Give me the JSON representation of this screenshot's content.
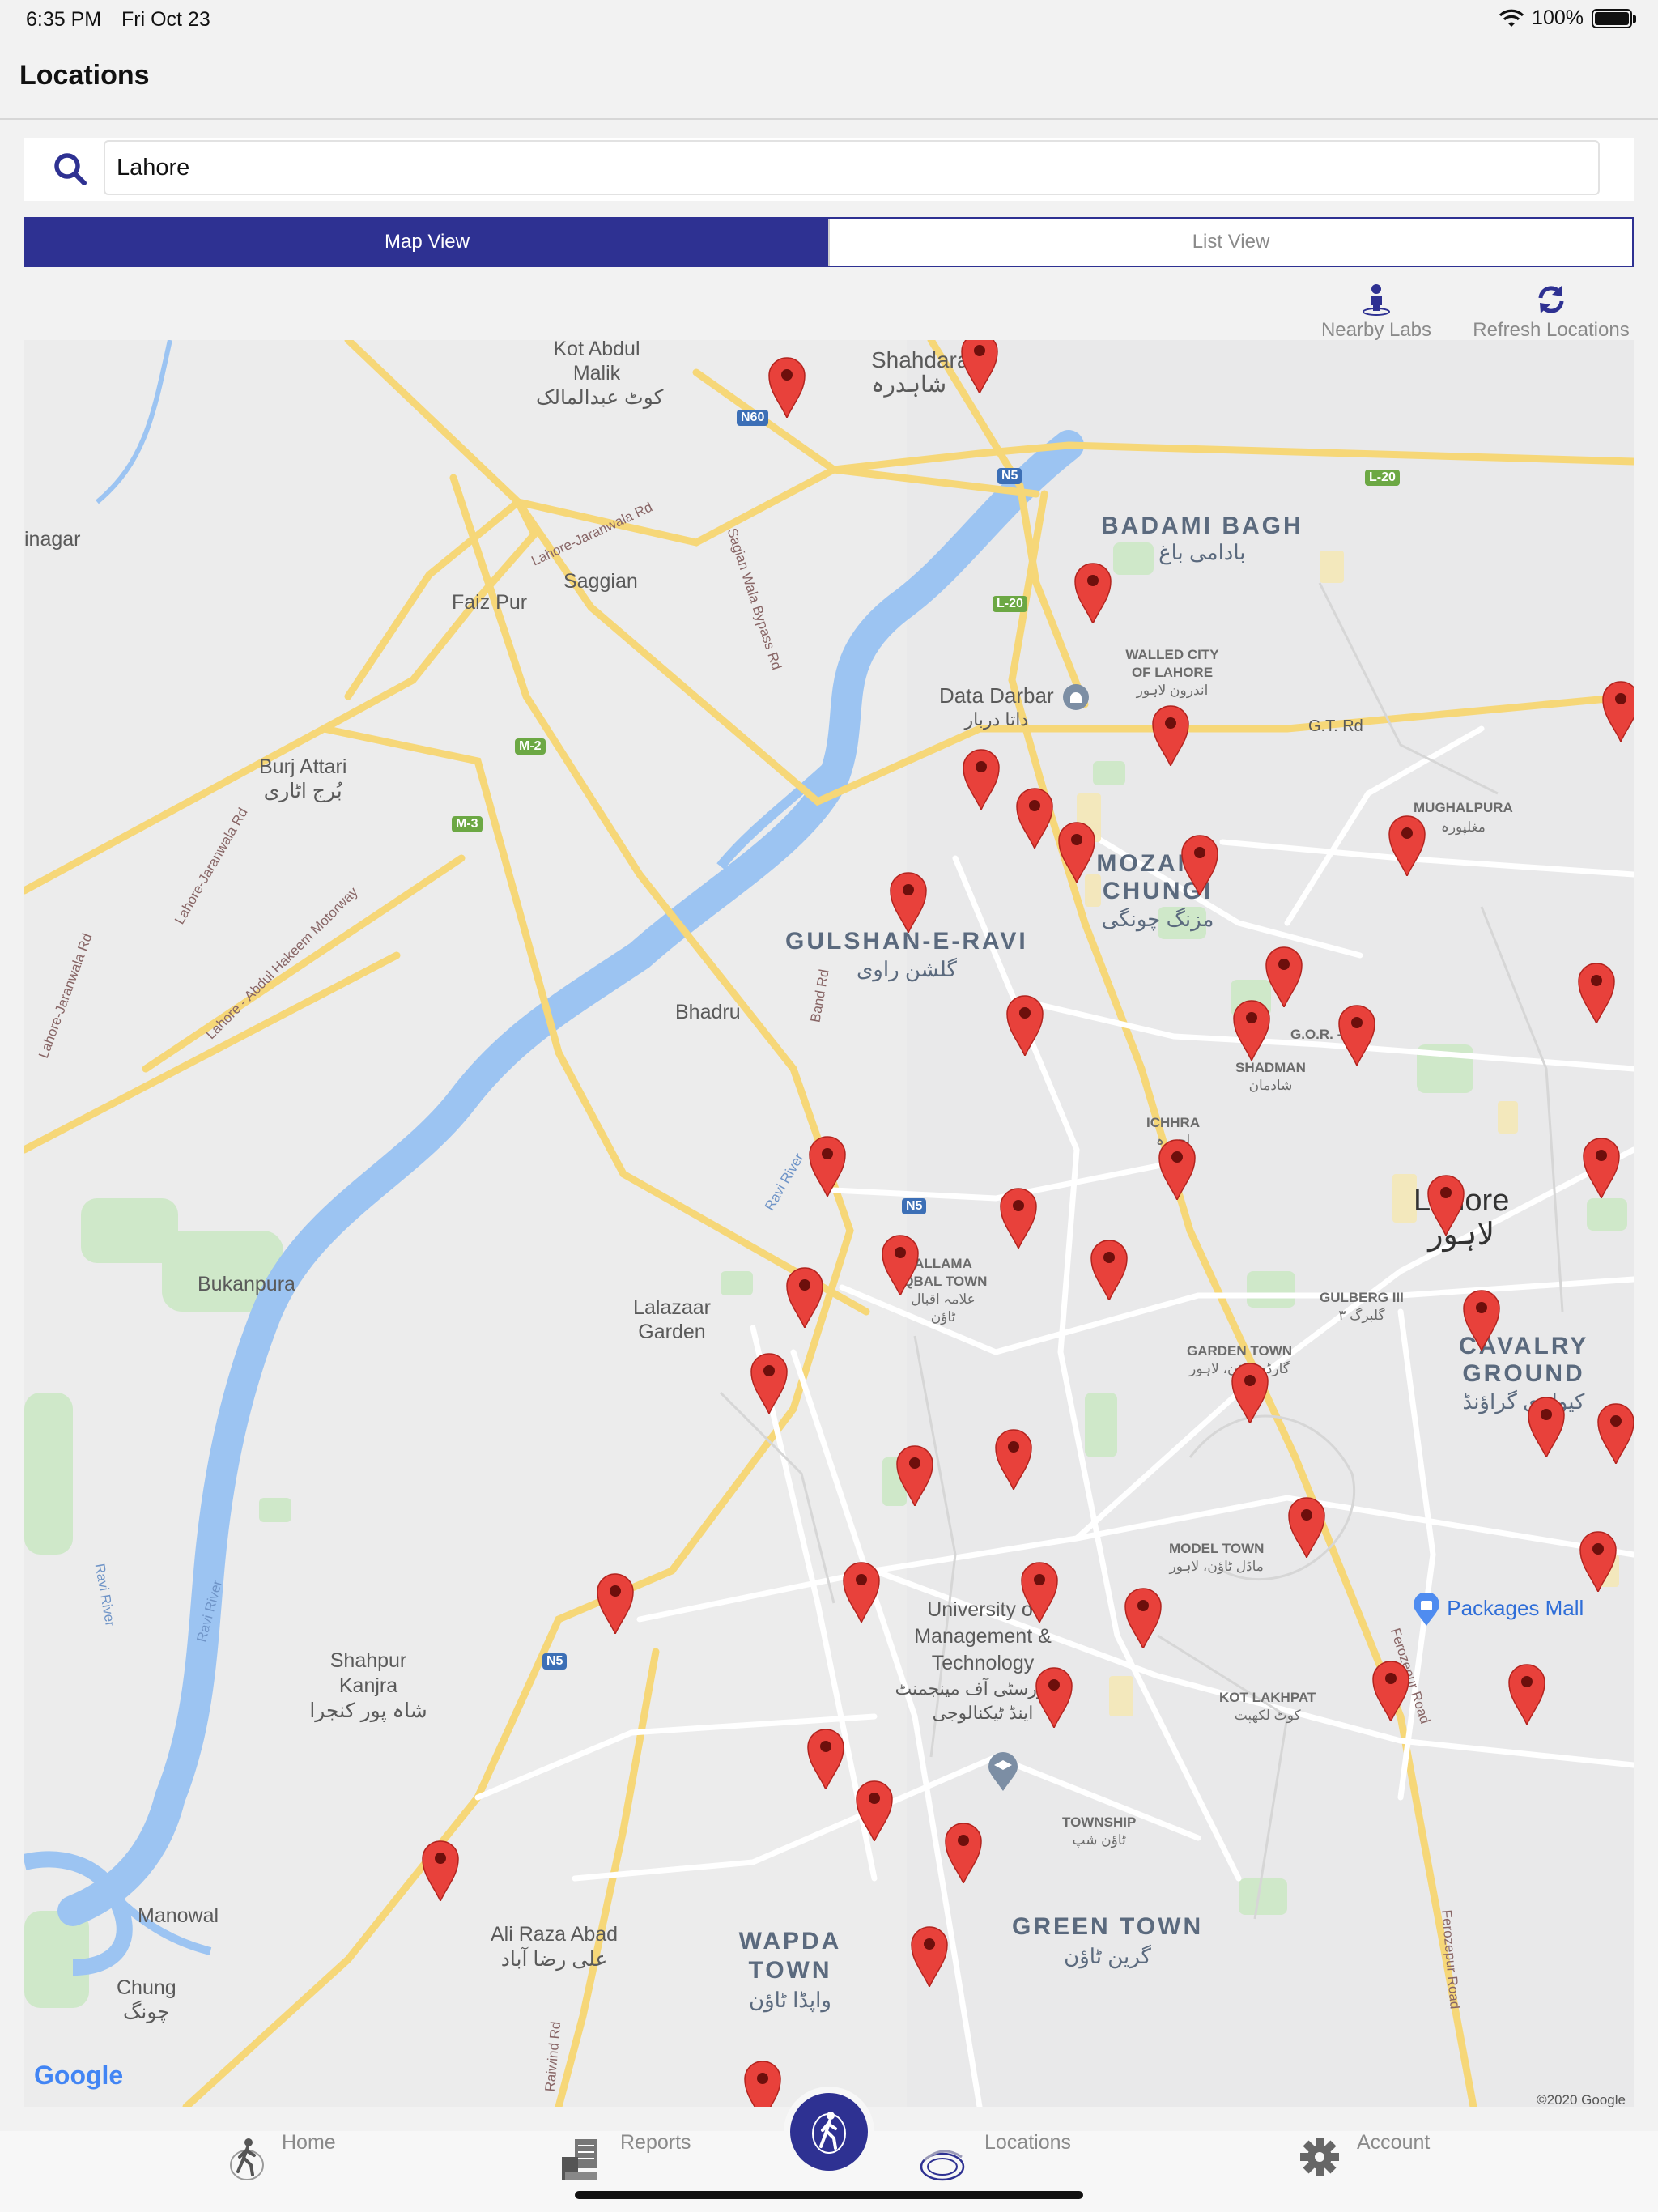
{
  "status_bar": {
    "time": "6:35 PM",
    "date": "Fri Oct 23",
    "battery": "100%",
    "battery_level": 1.0
  },
  "header": {
    "title": "Locations"
  },
  "search": {
    "value": "Lahore",
    "icon": "search-icon"
  },
  "view_toggle": {
    "map_label": "Map View",
    "list_label": "List View",
    "selected": "Map View"
  },
  "actions": {
    "nearby_label": "Nearby Labs",
    "refresh_label": "Refresh Locations"
  },
  "map": {
    "provider_logo": "Google",
    "copyright": "©2020 Google",
    "labels": {
      "kot_abdul_malik": "Kot Abdul Malik",
      "kot_abdul_malik_ur": "کوٹ عبدالمالک",
      "shahdara": "Shahdara",
      "shahdara_ur": "شاہدرہ",
      "badami_bagh": "BADAMI BAGH",
      "badami_bagh_ur": "بادامی باغ",
      "inagar": "inagar",
      "saggian": "Saggian",
      "faiz_pur": "Faiz Pur",
      "walled_city": "WALLED CITY OF LAHORE",
      "walled_city_ur": "اندرون لاہور",
      "data_darbar": "Data Darbar",
      "data_darbar_ur": "داتا دربار",
      "gt_rd": "G.T. Rd",
      "burj_attari": "Burj Attari",
      "burj_attari_ur": "بُرج اٹاری",
      "mughalpura": "MUGHALPURA",
      "mughalpura_ur": "مغلپورہ",
      "mozang": "MOZANG CHUNGI",
      "mozang_ur": "مزنگ چونگی",
      "gulshan": "GULSHAN-E-RAVI",
      "gulshan_ur": "گلشن راوی",
      "bhadru": "Bhadru",
      "gor": "G.O.R. - I",
      "shadman": "SHADMAN",
      "shadman_ur": "شادمان",
      "ichhra": "ICHHRA",
      "ichhra_ur": "اچھرہ",
      "lahore": "Lahore",
      "lahore_ur": "لاہور",
      "allama": "ALLAMA IQBAL TOWN",
      "allama_ur": "علامہ اقبال ٹاؤن",
      "lalazaar": "Lalazaar Garden",
      "gulberg": "GULBERG III",
      "gulberg_ur": "گلبرگ ۳",
      "garden_town": "GARDEN TOWN",
      "garden_town_ur": "گارڈن ٹاؤن، لاہور",
      "cavalry": "CAVALRY GROUND",
      "cavalry_ur": "کیولری گراؤنڈ",
      "bukanpura": "Bukanpura",
      "model_town": "MODEL TOWN",
      "model_town_ur": "ماڈل ٹاؤن، لاہور",
      "packages": "Packages Mall",
      "umt": "University of Management & Technology",
      "umt_ur": "یونیورسٹی آف مینجمنٹ اینڈ ٹیکنالوجی",
      "kot_lakhpat": "KOT LAKHPAT",
      "kot_lakhpat_ur": "کوٹ لکھپت",
      "shahpur": "Shahpur Kanjra",
      "shahpur_ur": "شاہ پور کنجرا",
      "township": "TOWNSHIP",
      "township_ur": "ٹاؤن شپ",
      "manowal": "Manowal",
      "ali_raza": "Ali Raza Abad",
      "ali_raza_ur": "علی رضا آباد",
      "wapda": "WAPDA TOWN",
      "wapda_ur": "واپڈا ٹاؤن",
      "green_town": "GREEN TOWN",
      "green_town_ur": "گرین ٹاؤن",
      "chung": "Chung",
      "chung_ur": "چونگ",
      "ravi_river": "Ravi River",
      "lahore_jaranwala": "Lahore-Jaranwala Rd",
      "sagian_bypass": "Sagian Wala Bypass Rd",
      "band_rd": "Band Rd",
      "motorway": "Lahore - Abdul Hakeem Motorway",
      "ferozepur": "Ferozepur Road",
      "raiwind": "Raiwind Rd"
    },
    "shields": {
      "n60": "N60",
      "n5": "N5",
      "l20": "L-20",
      "m2": "M-2",
      "m3": "M-3"
    },
    "marker_count": 47
  },
  "tabbar": {
    "home_label": "Home",
    "reports_label": "Reports",
    "locations_label": "Locations",
    "account_label": "Account"
  }
}
